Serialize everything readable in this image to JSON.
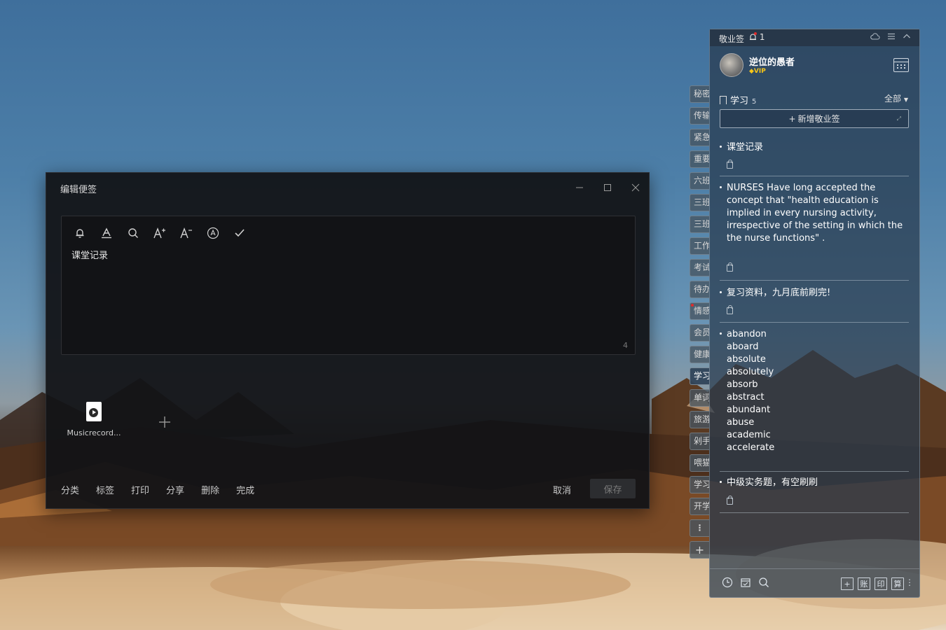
{
  "editor": {
    "title": "编辑便签",
    "minimize_icon": "minimize-icon",
    "maximize_icon": "maximize-icon",
    "close_icon": "close-icon",
    "toolbar": [
      "bell-icon",
      "text-color-icon",
      "search-icon",
      "font-increase-icon",
      "font-decrease-icon",
      "rotate-text-icon",
      "checkmark-icon"
    ],
    "content": "课堂记录",
    "char_count": "4",
    "attachment_name": "Musicrecord...",
    "actions": [
      "分类",
      "标签",
      "打印",
      "分享",
      "删除",
      "完成"
    ],
    "cancel": "取消",
    "save": "保存"
  },
  "tabs": [
    {
      "label": "秘密",
      "active": false
    },
    {
      "label": "传输",
      "active": false
    },
    {
      "label": "紧急",
      "active": false
    },
    {
      "label": "重要",
      "active": false
    },
    {
      "label": "六班",
      "active": false
    },
    {
      "label": "三班",
      "active": false
    },
    {
      "label": "三班",
      "active": false
    },
    {
      "label": "工作",
      "active": false
    },
    {
      "label": "考试",
      "active": false
    },
    {
      "label": "待办",
      "active": false
    },
    {
      "label": "情感",
      "active": false,
      "dot": true
    },
    {
      "label": "会员",
      "active": false
    },
    {
      "label": "健康",
      "active": false
    },
    {
      "label": "学习",
      "active": true
    },
    {
      "label": "单词",
      "active": false
    },
    {
      "label": "旅游",
      "active": false
    },
    {
      "label": "剁手",
      "active": false
    },
    {
      "label": "喂猫",
      "active": false
    },
    {
      "label": "学习",
      "active": false
    },
    {
      "label": "开学",
      "active": false
    }
  ],
  "tabs_more": "⋮",
  "tabs_add": "+",
  "panel": {
    "app_name": "敬业签",
    "reminder_count": "1",
    "user_name": "逆位的愚者",
    "vip_label": "VIP",
    "category": "学习",
    "category_count": "5",
    "filter": "全部",
    "new_note": "新增敬业签",
    "notes": [
      {
        "text": "课堂记录"
      },
      {
        "text": "NURSES Have long accepted the\nconcept that \"health education is\nimplied in every nursing activity,\nirrespective of the setting in which the\nthe nurse functions\" ."
      },
      {
        "text": "复习资料，九月底前刷完!"
      },
      {
        "text": "abandon\naboard\nabsolute\nabsolutely\nabsorb\nabstract\nabundant\nabuse\nacademic\naccelerate"
      },
      {
        "text": "中级实务题，有空刷刷"
      }
    ],
    "footer_left": [
      "clock-icon",
      "calendar-check-icon",
      "search-icon"
    ],
    "footer_right": [
      "+",
      "账",
      "印",
      "算"
    ]
  }
}
